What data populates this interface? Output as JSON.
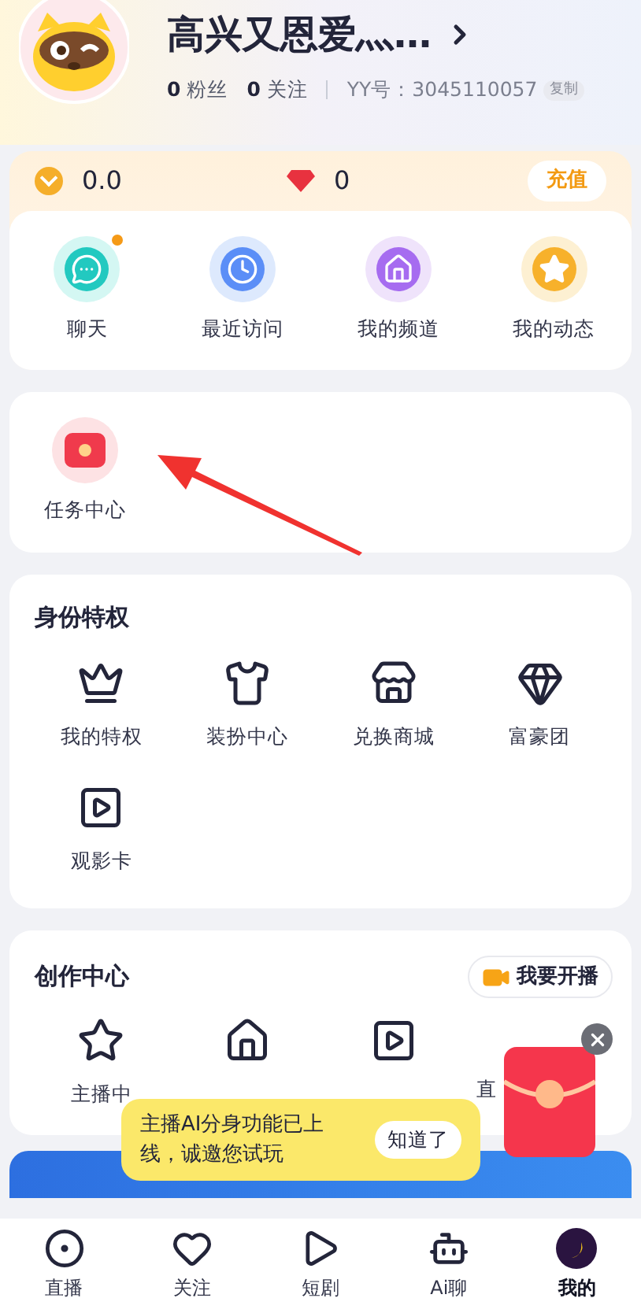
{
  "profile": {
    "name": "高兴又恩爱灬…",
    "fans_count": "0",
    "fans_label": "粉丝",
    "follow_count": "0",
    "follow_label": "关注",
    "yy_id": "YY号：3045110057",
    "copy_button": "复制"
  },
  "wallet": {
    "coins": "0.0",
    "diamonds": "0",
    "recharge_button": "充值"
  },
  "quick_actions": [
    {
      "label": "聊天",
      "kind": "chat",
      "badge": true
    },
    {
      "label": "最近访问",
      "kind": "recent",
      "badge": false
    },
    {
      "label": "我的频道",
      "kind": "channel",
      "badge": false
    },
    {
      "label": "我的动态",
      "kind": "moments",
      "badge": false
    }
  ],
  "task_center": {
    "label": "任务中心"
  },
  "privileges": {
    "title": "身份特权",
    "items": [
      {
        "label": "我的特权",
        "kind": "crown"
      },
      {
        "label": "装扮中心",
        "kind": "shirt"
      },
      {
        "label": "兑换商城",
        "kind": "store"
      },
      {
        "label": "富豪团",
        "kind": "diamond"
      },
      {
        "label": "观影卡",
        "kind": "ticket"
      }
    ]
  },
  "creation": {
    "title": "创作中心",
    "start_live_button": "我要开播",
    "items": [
      {
        "label": "主播中",
        "kind": "star"
      },
      {
        "kind": "house"
      },
      {
        "kind": "video"
      },
      {
        "label": "直"
      }
    ]
  },
  "tooltip": {
    "text": "主播AI分身功能已上线，诚邀您试玩",
    "button": "知道了"
  },
  "tab_bar": [
    {
      "label": "直播",
      "kind": "live",
      "selected": false
    },
    {
      "label": "关注",
      "kind": "heart",
      "selected": false
    },
    {
      "label": "短剧",
      "kind": "play",
      "selected": false
    },
    {
      "label": "Ai聊",
      "kind": "ai",
      "selected": false
    },
    {
      "label": "我的",
      "kind": "me",
      "selected": true
    }
  ]
}
